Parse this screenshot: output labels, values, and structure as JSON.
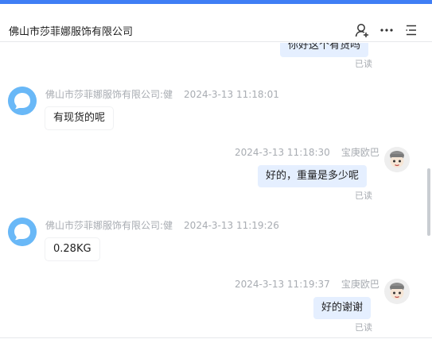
{
  "header": {
    "title": "佛山市莎菲娜服饰有限公司"
  },
  "messages": [
    {
      "direction": "out",
      "text": "你好这个有货吗",
      "status": "已读"
    },
    {
      "direction": "in",
      "sender": "佛山市莎菲娜服饰有限公司:健",
      "time": "2024-3-13 11:18:01",
      "text": "有现货的呢"
    },
    {
      "direction": "out",
      "sender": "宝庚欧巴",
      "time": "2024-3-13 11:18:30",
      "text": "好的，重量是多少呢",
      "status": "已读"
    },
    {
      "direction": "in",
      "sender": "佛山市莎菲娜服饰有限公司:健",
      "time": "2024-3-13 11:19:26",
      "text": "0.28KG"
    },
    {
      "direction": "out",
      "sender": "宝庚欧巴",
      "time": "2024-3-13 11:19:37",
      "text": "好的谢谢",
      "status": "已读"
    }
  ],
  "icons": {
    "header": [
      "user-add-icon",
      "more-icon",
      "list-icon"
    ]
  },
  "colors": {
    "accent": "#3f7ef5",
    "bubble_out": "#e5efff",
    "bubble_in": "#ffffff",
    "avatar_in": "#69b8f7",
    "meta_text": "#a8acb2"
  }
}
